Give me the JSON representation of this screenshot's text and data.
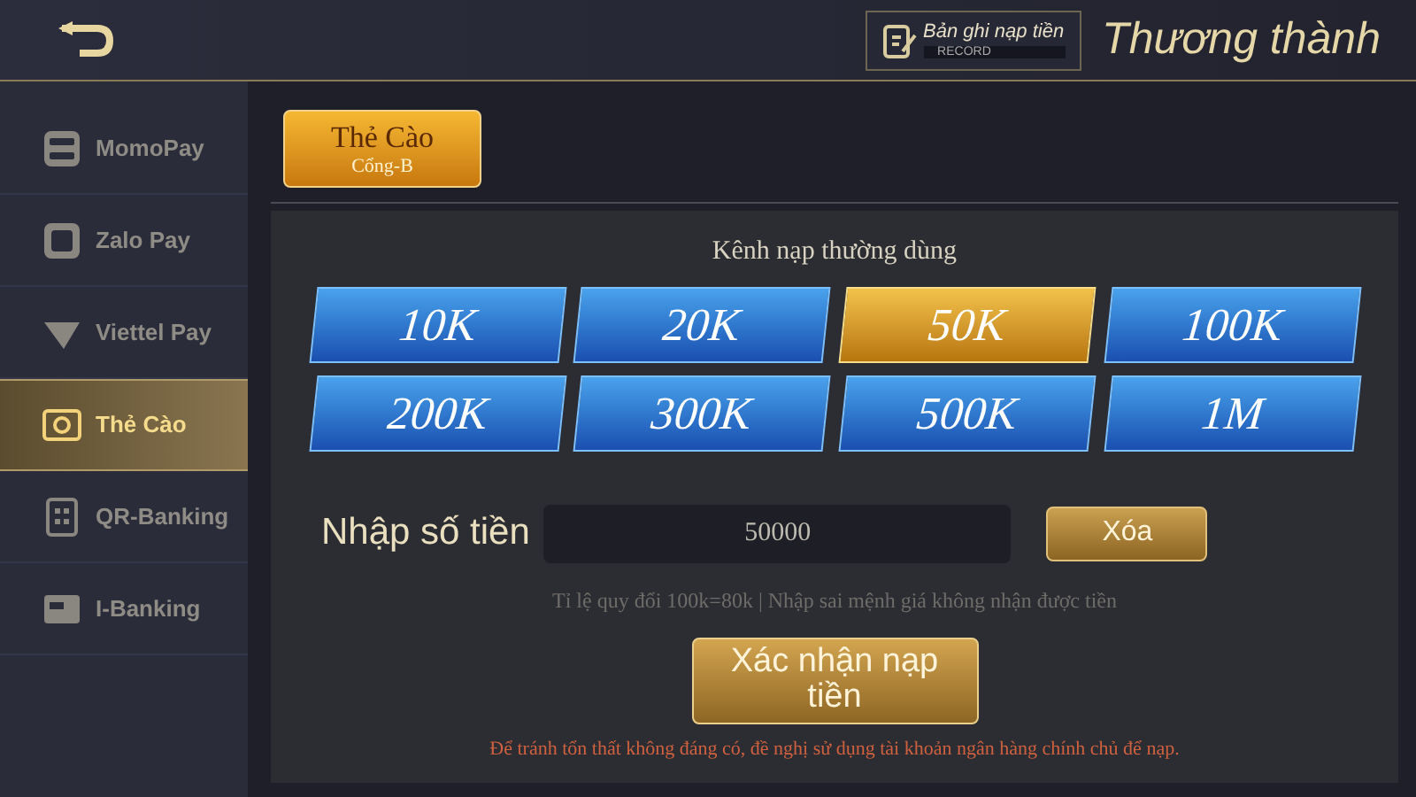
{
  "header": {
    "record_button": {
      "label": "Bản ghi nạp tiền",
      "sublabel": "RECORD"
    },
    "title": "Thương thành"
  },
  "sidebar": {
    "items": [
      {
        "label": "MomoPay",
        "kind": "momo",
        "selected": false
      },
      {
        "label": "Zalo Pay",
        "kind": "zalo",
        "selected": false
      },
      {
        "label": "Viettel Pay",
        "kind": "viettel",
        "selected": false
      },
      {
        "label": "Thẻ Cào",
        "kind": "card",
        "selected": true
      },
      {
        "label": "QR-Banking",
        "kind": "qr",
        "selected": false
      },
      {
        "label": "I-Banking",
        "kind": "bank",
        "selected": false
      }
    ]
  },
  "gateway_tabs": [
    {
      "label": "Thẻ Cào",
      "sublabel": "Cổng-B",
      "selected": true
    }
  ],
  "panel": {
    "heading": "Kênh nạp thường dùng",
    "amounts": [
      {
        "label": "10K",
        "selected": false
      },
      {
        "label": "20K",
        "selected": false
      },
      {
        "label": "50K",
        "selected": true
      },
      {
        "label": "100K",
        "selected": false
      },
      {
        "label": "200K",
        "selected": false
      },
      {
        "label": "300K",
        "selected": false
      },
      {
        "label": "500K",
        "selected": false
      },
      {
        "label": "1M",
        "selected": false
      }
    ],
    "amount_field": {
      "label": "Nhập số tiền",
      "value": "50000"
    },
    "clear_button": "Xóa",
    "rate_note": "Tỉ lệ quy đổi 100k=80k | Nhập sai mệnh giá không nhận được tiền",
    "confirm_button": "Xác nhận nạp tiền",
    "warning": "Để tránh tổn thất không đáng có, đề nghị sử dụng tài khoản ngân hàng chính chủ để nạp."
  }
}
